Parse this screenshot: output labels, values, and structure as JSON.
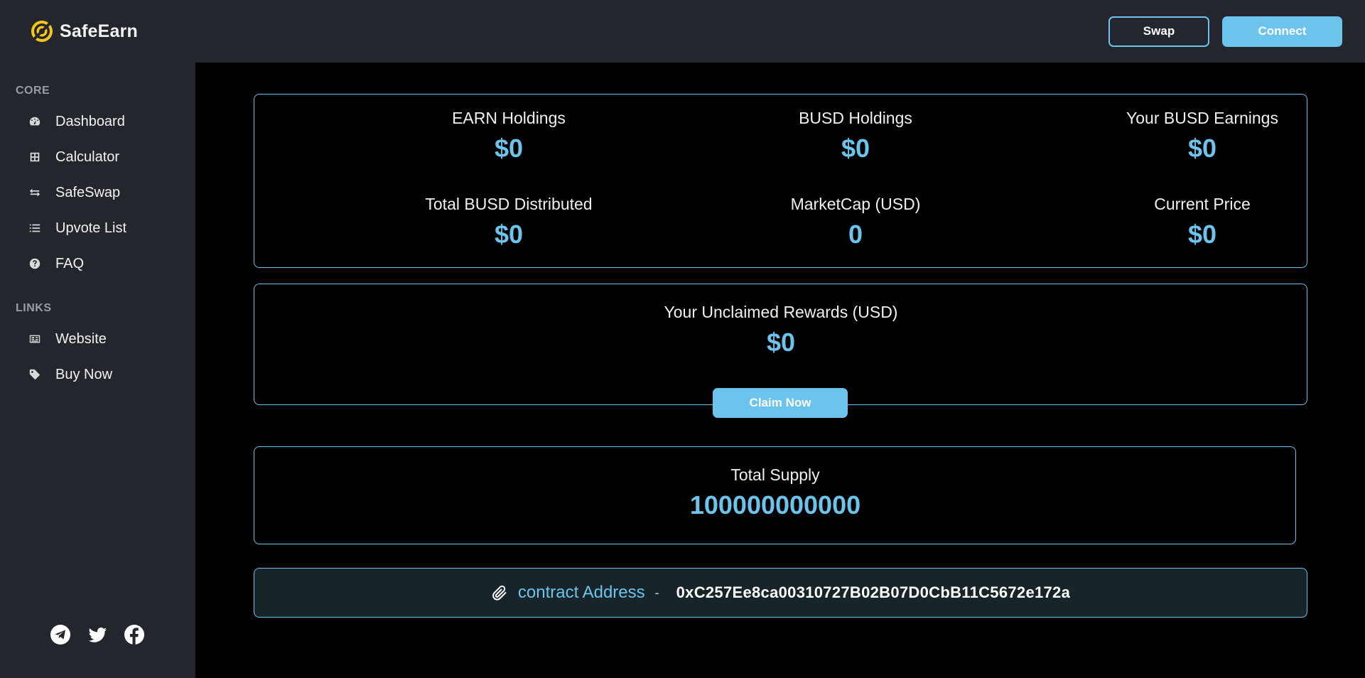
{
  "header": {
    "brand": "SafeEarn",
    "swap_label": "Swap",
    "connect_label": "Connect"
  },
  "sidebar": {
    "core_label": "CORE",
    "core_items": [
      {
        "label": "Dashboard",
        "icon": "dashboard-icon"
      },
      {
        "label": "Calculator",
        "icon": "calculator-icon"
      },
      {
        "label": "SafeSwap",
        "icon": "swap-icon"
      },
      {
        "label": "Upvote List",
        "icon": "list-icon"
      },
      {
        "label": "FAQ",
        "icon": "question-icon"
      }
    ],
    "links_label": "LINKS",
    "link_items": [
      {
        "label": "Website",
        "icon": "website-icon"
      },
      {
        "label": "Buy Now",
        "icon": "tag-icon"
      }
    ],
    "socials": [
      "telegram-icon",
      "twitter-icon",
      "facebook-icon"
    ]
  },
  "stats": [
    {
      "label": "EARN Holdings",
      "value": "$0"
    },
    {
      "label": "BUSD Holdings",
      "value": "$0"
    },
    {
      "label": "Your BUSD Earnings",
      "value": "$0"
    },
    {
      "label": "Total BUSD Distributed",
      "value": "$0"
    },
    {
      "label": "MarketCap (USD)",
      "value": "0"
    },
    {
      "label": "Current Price",
      "value": "$0"
    }
  ],
  "rewards": {
    "label": "Your Unclaimed Rewards (USD)",
    "value": "$0",
    "claim_label": "Claim Now"
  },
  "supply": {
    "label": "Total Supply",
    "value": "100000000000"
  },
  "contract": {
    "label": "contract Address",
    "separator": "-",
    "value": "0xC257Ee8ca00310727B02B07D0CbB11C5672e172a"
  },
  "colors": {
    "accent": "#6cc3ec",
    "panel": "#23262c",
    "background": "#000000"
  }
}
